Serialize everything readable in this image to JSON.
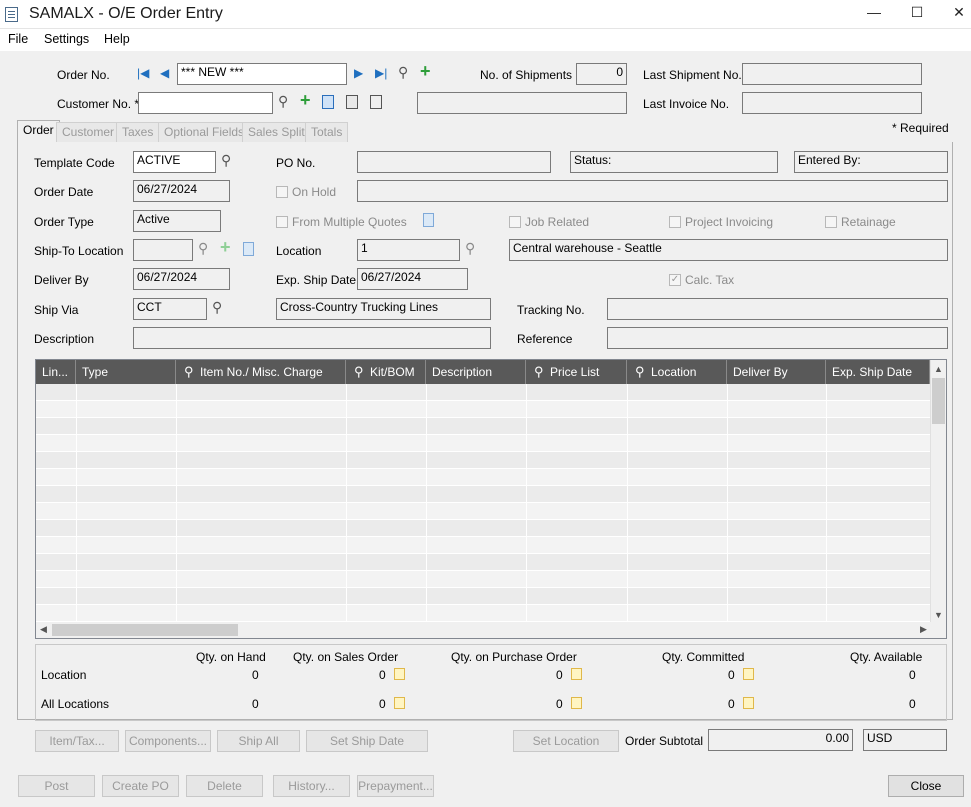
{
  "window": {
    "title": "SAMALX - O/E Order Entry",
    "minimize": "—",
    "maximize": "☐",
    "close": "✕"
  },
  "menu": [
    "File",
    "Settings",
    "Help"
  ],
  "header": {
    "order_no_label": "Order No.",
    "order_no": "*** NEW ***",
    "customer_no_label": "Customer No. *",
    "customer_no": "",
    "customer_name": "",
    "shipments_label": "No. of Shipments",
    "shipments": "0",
    "last_shipment_label": "Last Shipment No.",
    "last_shipment": "",
    "last_invoice_label": "Last Invoice No.",
    "last_invoice": ""
  },
  "tabs": [
    "Order",
    "Customer",
    "Taxes",
    "Optional Fields",
    "Sales Split",
    "Totals"
  ],
  "required_note": "*  Required",
  "form": {
    "template_code_label": "Template Code",
    "template_code": "ACTIVE",
    "po_label": "PO No.",
    "po": "",
    "status_label": "Status:",
    "entered_by_label": "Entered By:",
    "order_date_label": "Order Date",
    "order_date": "06/27/2024",
    "on_hold_label": "On Hold",
    "on_hold_text": "",
    "order_type_label": "Order Type",
    "order_type": "Active",
    "from_multiple_quotes_label": "From Multiple Quotes",
    "job_related_label": "Job Related",
    "project_invoicing_label": "Project Invoicing",
    "retainage_label": "Retainage",
    "ship_to_label": "Ship-To Location",
    "ship_to": "",
    "location_label": "Location",
    "location": "1",
    "location_desc": "Central warehouse - Seattle",
    "deliver_by_label": "Deliver By",
    "deliver_by": "06/27/2024",
    "exp_ship_label": "Exp. Ship Date",
    "exp_ship": "06/27/2024",
    "calc_tax_label": "Calc. Tax",
    "ship_via_label": "Ship Via",
    "ship_via": "CCT",
    "ship_via_desc": "Cross-Country Trucking Lines",
    "tracking_label": "Tracking No.",
    "tracking": "",
    "description_label": "Description",
    "description": "",
    "reference_label": "Reference",
    "reference": ""
  },
  "grid": {
    "columns": [
      "Lin...",
      "Type",
      "Item No./ Misc. Charge",
      "Kit/BOM",
      "Description",
      "Price List",
      "Location",
      "Deliver By",
      "Exp. Ship Date"
    ]
  },
  "quantities": {
    "headers": [
      "Qty. on Hand",
      "Qty. on Sales Order",
      "Qty. on Purchase Order",
      "Qty. Committed",
      "Qty. Available"
    ],
    "rows": [
      {
        "label": "Location",
        "values": [
          "0",
          "0",
          "0",
          "0",
          "0"
        ]
      },
      {
        "label": "All Locations",
        "values": [
          "0",
          "0",
          "0",
          "0",
          "0"
        ]
      }
    ]
  },
  "actions": {
    "item_tax": "Item/Tax...",
    "components": "Components...",
    "ship_all": "Ship All",
    "set_ship_date": "Set Ship Date",
    "set_location": "Set Location"
  },
  "subtotal": {
    "label": "Order Subtotal",
    "value": "0.00",
    "currency": "USD"
  },
  "footer": {
    "post": "Post",
    "create_po": "Create PO",
    "delete": "Delete",
    "history": "History...",
    "prepayment": "Prepayment...",
    "close": "Close"
  }
}
